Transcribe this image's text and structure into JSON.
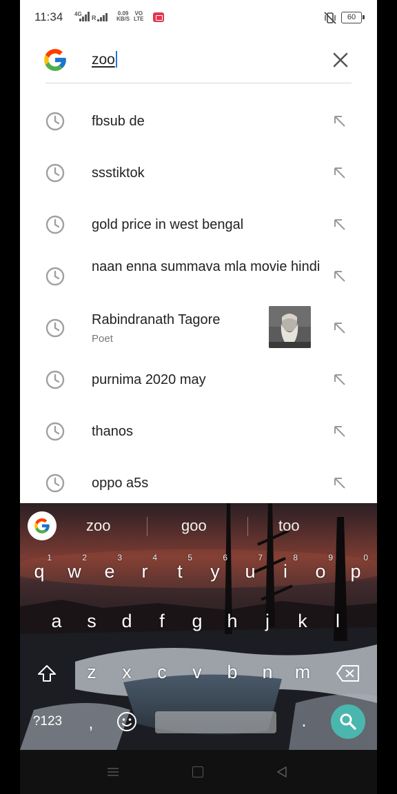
{
  "status_bar": {
    "time": "11:34",
    "net_label": "4G",
    "roaming_label": "R",
    "speed_value": "0.09",
    "speed_unit": "KB/S",
    "volte_top": "VO",
    "volte_bottom": "LTE",
    "battery": "60"
  },
  "search": {
    "query": "zoo",
    "clear_icon": "close-icon",
    "logo": "google-logo"
  },
  "suggestions": [
    {
      "text": "fbsub de"
    },
    {
      "text": "ssstiktok"
    },
    {
      "text": "gold price in west bengal"
    },
    {
      "text": "naan enna summava mla movie hindi"
    },
    {
      "text": "Rabindranath Tagore",
      "subtitle": "Poet"
    },
    {
      "text": "purnima 2020 may"
    },
    {
      "text": "thanos"
    },
    {
      "text": "oppo a5s"
    }
  ],
  "keyboard": {
    "word_suggestions": [
      "zoo",
      "goo",
      "too"
    ],
    "row1": [
      {
        "key": "q",
        "hint": "1"
      },
      {
        "key": "w",
        "hint": "2"
      },
      {
        "key": "e",
        "hint": "3"
      },
      {
        "key": "r",
        "hint": "4"
      },
      {
        "key": "t",
        "hint": "5"
      },
      {
        "key": "y",
        "hint": "6"
      },
      {
        "key": "u",
        "hint": "7"
      },
      {
        "key": "i",
        "hint": "8"
      },
      {
        "key": "o",
        "hint": "9"
      },
      {
        "key": "p",
        "hint": "0"
      }
    ],
    "row2": [
      "a",
      "s",
      "d",
      "f",
      "g",
      "h",
      "j",
      "k",
      "l"
    ],
    "row3": [
      "z",
      "x",
      "c",
      "v",
      "b",
      "n",
      "m"
    ],
    "symbols_label": "?123",
    "comma_label": ",",
    "period_label": "."
  },
  "colors": {
    "accent": "#1a73e8",
    "search_key": "#4bb6ad",
    "record_badge": "#e53450"
  }
}
